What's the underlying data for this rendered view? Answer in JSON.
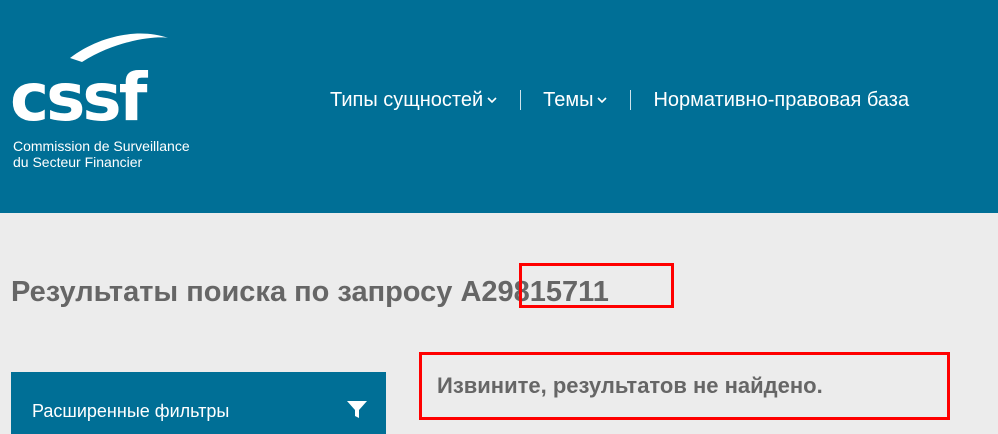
{
  "colors": {
    "header_bg": "#006f96",
    "page_bg": "#ececec",
    "text_gray": "#666666",
    "highlight_border": "#ff0000"
  },
  "logo": {
    "wordmark": "cssf",
    "subtitle_line1": "Commission de Surveillance",
    "subtitle_line2": "du Secteur Financier"
  },
  "nav": {
    "items": [
      {
        "label": "Типы сущностей",
        "has_dropdown": true,
        "icon": "chevron-down-icon"
      },
      {
        "label": "Темы",
        "has_dropdown": true,
        "icon": "chevron-down-icon"
      },
      {
        "label": "Нормативно-правовая база",
        "has_dropdown": false
      }
    ]
  },
  "search": {
    "title_prefix": "Результаты поиска по запросу",
    "query": "A29815711"
  },
  "filters": {
    "label": "Расширенные фильтры",
    "icon": "filter-icon"
  },
  "results": {
    "message": "Извините, результатов не найдено."
  }
}
